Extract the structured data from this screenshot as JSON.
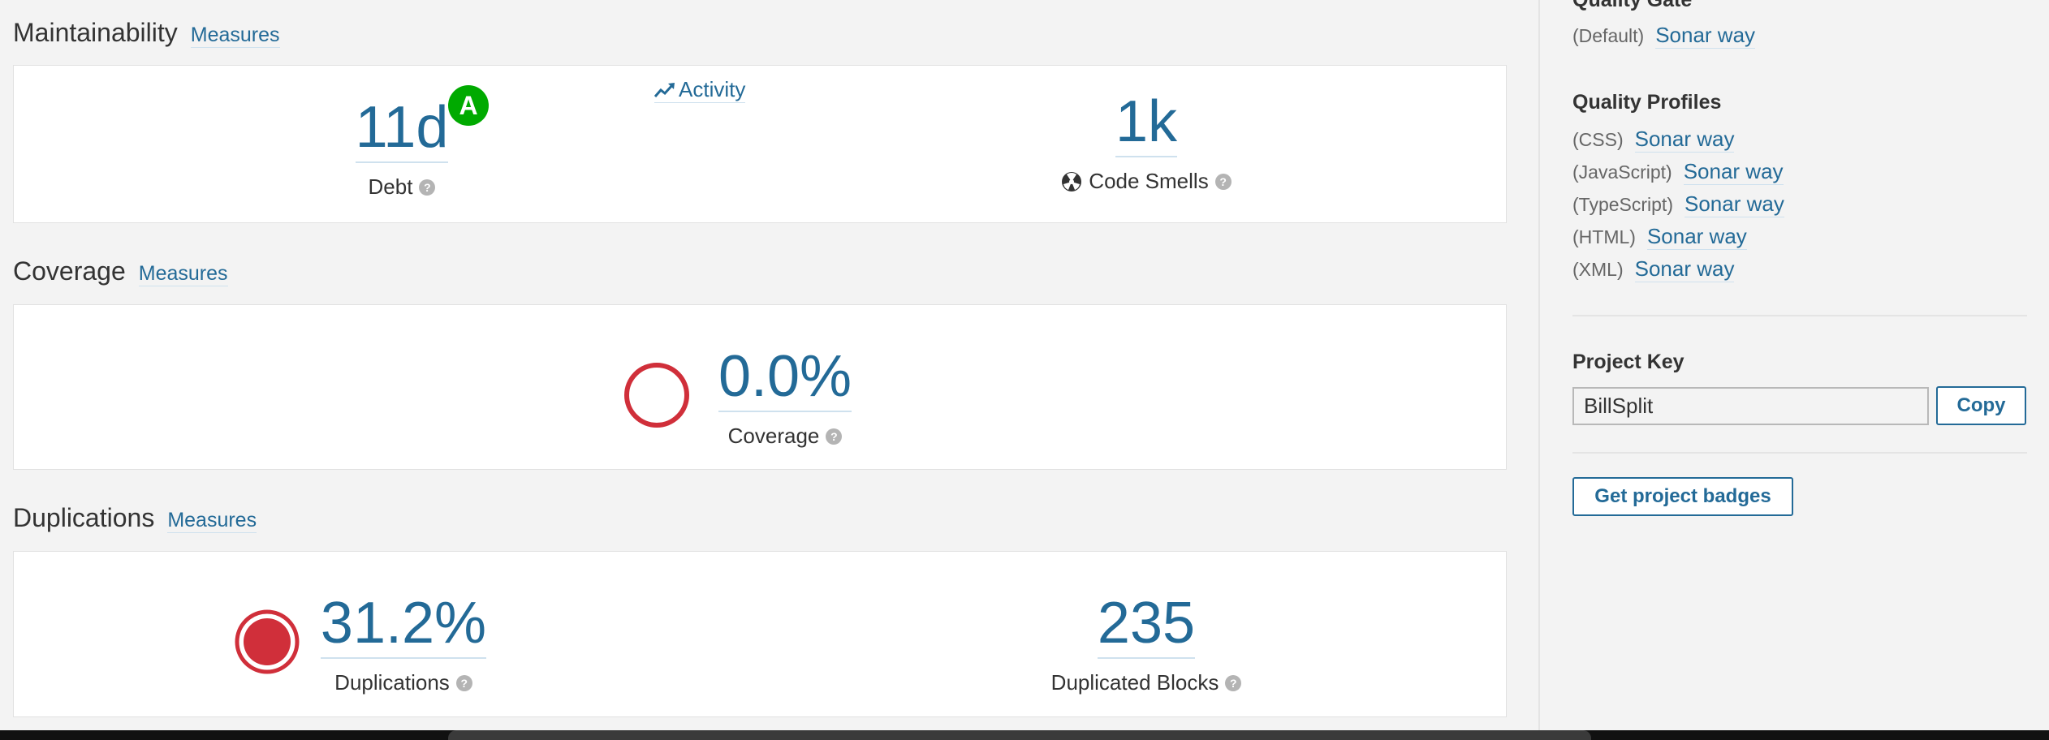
{
  "maintainability": {
    "title": "Maintainability",
    "measures_link": "Measures",
    "debt_value": "11d",
    "debt_label": "Debt",
    "rating": "A",
    "activity_link": "Activity",
    "smells_value": "1k",
    "smells_label": "Code Smells"
  },
  "coverage": {
    "title": "Coverage",
    "measures_link": "Measures",
    "value": "0.0%",
    "label": "Coverage"
  },
  "duplications": {
    "title": "Duplications",
    "measures_link": "Measures",
    "value": "31.2%",
    "label": "Duplications",
    "blocks_value": "235",
    "blocks_label": "Duplicated Blocks"
  },
  "sidebar": {
    "quality_gate_title": "Quality Gate",
    "quality_gate": {
      "lang": "(Default)",
      "link": "Sonar way"
    },
    "quality_profiles_title": "Quality Profiles",
    "profiles": [
      {
        "lang": "(CSS)",
        "link": "Sonar way"
      },
      {
        "lang": "(JavaScript)",
        "link": "Sonar way"
      },
      {
        "lang": "(TypeScript)",
        "link": "Sonar way"
      },
      {
        "lang": "(HTML)",
        "link": "Sonar way"
      },
      {
        "lang": "(XML)",
        "link": "Sonar way"
      }
    ],
    "project_key_title": "Project Key",
    "project_key_value": "BillSplit",
    "copy_button": "Copy",
    "badges_button": "Get project badges"
  },
  "colors": {
    "link": "#236a97",
    "rating_a": "#00aa00",
    "error_red": "#d02f3a"
  }
}
